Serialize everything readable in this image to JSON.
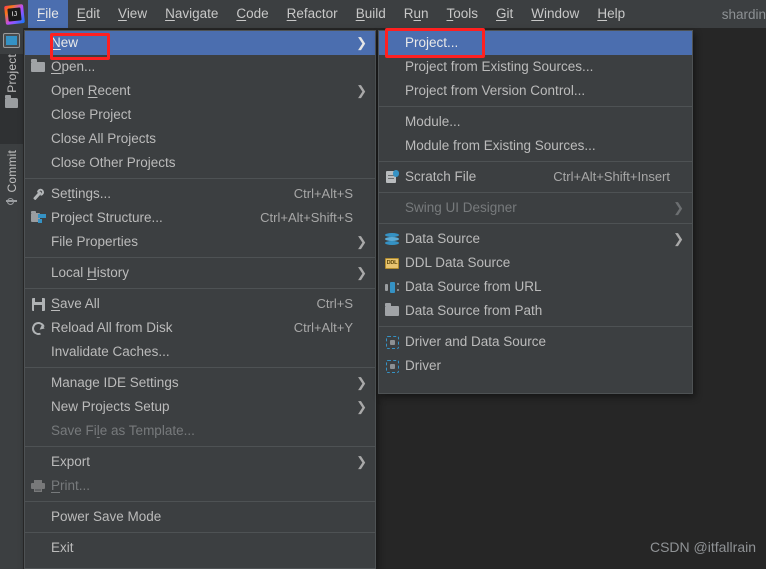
{
  "window": {
    "title_right": "shardin",
    "watermark": "CSDN @itfallrain"
  },
  "logo": {
    "text": "IJ",
    "name": "intellij-idea-logo"
  },
  "menubar": {
    "items": [
      {
        "label": "File",
        "mnemonic": "F",
        "active": true
      },
      {
        "label": "Edit",
        "mnemonic": "E",
        "active": false
      },
      {
        "label": "View",
        "mnemonic": "V",
        "active": false
      },
      {
        "label": "Navigate",
        "mnemonic": "N",
        "active": false
      },
      {
        "label": "Code",
        "mnemonic": "C",
        "active": false
      },
      {
        "label": "Refactor",
        "mnemonic": "R",
        "active": false
      },
      {
        "label": "Build",
        "mnemonic": "B",
        "active": false
      },
      {
        "label": "Run",
        "mnemonic": "u",
        "active": false
      },
      {
        "label": "Tools",
        "mnemonic": "T",
        "active": false
      },
      {
        "label": "Git",
        "mnemonic": "G",
        "active": false
      },
      {
        "label": "Window",
        "mnemonic": "W",
        "active": false
      },
      {
        "label": "Help",
        "mnemonic": "H",
        "active": false
      }
    ]
  },
  "sidebar": {
    "items": [
      {
        "label": "Project",
        "icon": "folder-icon",
        "selected": true
      },
      {
        "label": "Commit",
        "icon": "commit-icon",
        "selected": false
      }
    ]
  },
  "file_menu": {
    "name": "File",
    "rows": [
      {
        "kind": "item",
        "label": "New",
        "mnemonic": "N",
        "icon": "",
        "accel": "",
        "arrow": true,
        "selected": true,
        "disabled": false
      },
      {
        "kind": "item",
        "label": "Open...",
        "mnemonic": "O",
        "icon": "folder-icon",
        "accel": "",
        "arrow": false,
        "selected": false,
        "disabled": false
      },
      {
        "kind": "item",
        "label": "Open Recent",
        "mnemonic": "R",
        "icon": "",
        "accel": "",
        "arrow": true,
        "selected": false,
        "disabled": false
      },
      {
        "kind": "item",
        "label": "Close Project",
        "mnemonic": "",
        "icon": "",
        "accel": "",
        "arrow": false,
        "selected": false,
        "disabled": false
      },
      {
        "kind": "item",
        "label": "Close All Projects",
        "mnemonic": "",
        "icon": "",
        "accel": "",
        "arrow": false,
        "selected": false,
        "disabled": false
      },
      {
        "kind": "item",
        "label": "Close Other Projects",
        "mnemonic": "",
        "icon": "",
        "accel": "",
        "arrow": false,
        "selected": false,
        "disabled": false
      },
      {
        "kind": "sep"
      },
      {
        "kind": "item",
        "label": "Settings...",
        "mnemonic": "t",
        "icon": "wrench-icon",
        "accel": "Ctrl+Alt+S",
        "arrow": false,
        "selected": false,
        "disabled": false
      },
      {
        "kind": "item",
        "label": "Project Structure...",
        "mnemonic": "",
        "icon": "project-structure-icon",
        "accel": "Ctrl+Alt+Shift+S",
        "arrow": false,
        "selected": false,
        "disabled": false
      },
      {
        "kind": "item",
        "label": "File Properties",
        "mnemonic": "",
        "icon": "",
        "accel": "",
        "arrow": true,
        "selected": false,
        "disabled": false
      },
      {
        "kind": "sep"
      },
      {
        "kind": "item",
        "label": "Local History",
        "mnemonic": "H",
        "icon": "",
        "accel": "",
        "arrow": true,
        "selected": false,
        "disabled": false
      },
      {
        "kind": "sep"
      },
      {
        "kind": "item",
        "label": "Save All",
        "mnemonic": "S",
        "icon": "save-icon",
        "accel": "Ctrl+S",
        "arrow": false,
        "selected": false,
        "disabled": false
      },
      {
        "kind": "item",
        "label": "Reload All from Disk",
        "mnemonic": "",
        "icon": "reload-icon",
        "accel": "Ctrl+Alt+Y",
        "arrow": false,
        "selected": false,
        "disabled": false
      },
      {
        "kind": "item",
        "label": "Invalidate Caches...",
        "mnemonic": "",
        "icon": "",
        "accel": "",
        "arrow": false,
        "selected": false,
        "disabled": false
      },
      {
        "kind": "sep"
      },
      {
        "kind": "item",
        "label": "Manage IDE Settings",
        "mnemonic": "",
        "icon": "",
        "accel": "",
        "arrow": true,
        "selected": false,
        "disabled": false
      },
      {
        "kind": "item",
        "label": "New Projects Setup",
        "mnemonic": "",
        "icon": "",
        "accel": "",
        "arrow": true,
        "selected": false,
        "disabled": false
      },
      {
        "kind": "item",
        "label": "Save File as Template...",
        "mnemonic": "l",
        "icon": "",
        "accel": "",
        "arrow": false,
        "selected": false,
        "disabled": true
      },
      {
        "kind": "sep"
      },
      {
        "kind": "item",
        "label": "Export",
        "mnemonic": "",
        "icon": "",
        "accel": "",
        "arrow": true,
        "selected": false,
        "disabled": false
      },
      {
        "kind": "item",
        "label": "Print...",
        "mnemonic": "P",
        "icon": "print-icon",
        "accel": "",
        "arrow": false,
        "selected": false,
        "disabled": true
      },
      {
        "kind": "sep"
      },
      {
        "kind": "item",
        "label": "Power Save Mode",
        "mnemonic": "",
        "icon": "",
        "accel": "",
        "arrow": false,
        "selected": false,
        "disabled": false
      },
      {
        "kind": "sep"
      },
      {
        "kind": "item",
        "label": "Exit",
        "mnemonic": "",
        "icon": "",
        "accel": "",
        "arrow": false,
        "selected": false,
        "disabled": false
      }
    ]
  },
  "new_submenu": {
    "name": "New",
    "rows": [
      {
        "kind": "item",
        "label": "Project...",
        "icon": "",
        "accel": "",
        "arrow": false,
        "selected": true,
        "disabled": false
      },
      {
        "kind": "item",
        "label": "Project from Existing Sources...",
        "icon": "",
        "accel": "",
        "arrow": false,
        "selected": false,
        "disabled": false
      },
      {
        "kind": "item",
        "label": "Project from Version Control...",
        "icon": "",
        "accel": "",
        "arrow": false,
        "selected": false,
        "disabled": false
      },
      {
        "kind": "sep"
      },
      {
        "kind": "item",
        "label": "Module...",
        "icon": "",
        "accel": "",
        "arrow": false,
        "selected": false,
        "disabled": false
      },
      {
        "kind": "item",
        "label": "Module from Existing Sources...",
        "icon": "",
        "accel": "",
        "arrow": false,
        "selected": false,
        "disabled": false
      },
      {
        "kind": "sep"
      },
      {
        "kind": "item",
        "label": "Scratch File",
        "icon": "scratch-file-icon",
        "accel": "Ctrl+Alt+Shift+Insert",
        "arrow": false,
        "selected": false,
        "disabled": false
      },
      {
        "kind": "sep"
      },
      {
        "kind": "item",
        "label": "Swing UI Designer",
        "icon": "",
        "accel": "",
        "arrow": true,
        "selected": false,
        "disabled": true
      },
      {
        "kind": "sep"
      },
      {
        "kind": "item",
        "label": "Data Source",
        "icon": "database-icon",
        "accel": "",
        "arrow": true,
        "selected": false,
        "disabled": false
      },
      {
        "kind": "item",
        "label": "DDL Data Source",
        "icon": "ddl-icon",
        "accel": "",
        "arrow": false,
        "selected": false,
        "disabled": false
      },
      {
        "kind": "item",
        "label": "Data Source from URL",
        "icon": "url-icon",
        "accel": "",
        "arrow": false,
        "selected": false,
        "disabled": false
      },
      {
        "kind": "item",
        "label": "Data Source from Path",
        "icon": "folder-icon",
        "accel": "",
        "arrow": false,
        "selected": false,
        "disabled": false
      },
      {
        "kind": "sep"
      },
      {
        "kind": "item",
        "label": "Driver and Data Source",
        "icon": "driver-icon",
        "accel": "",
        "arrow": false,
        "selected": false,
        "disabled": false
      },
      {
        "kind": "item",
        "label": "Driver",
        "icon": "driver-icon",
        "accel": "",
        "arrow": false,
        "selected": false,
        "disabled": false
      }
    ]
  },
  "annotations": [
    {
      "name": "red-highlight-new",
      "target": "New"
    },
    {
      "name": "red-highlight-project",
      "target": "Project..."
    }
  ],
  "colors": {
    "accent_blue": "#4b6eaf",
    "panel_bg": "#3c3f41",
    "app_bg": "#262626",
    "annotation_red": "#ff2020",
    "icon_blue": "#3592c4"
  }
}
